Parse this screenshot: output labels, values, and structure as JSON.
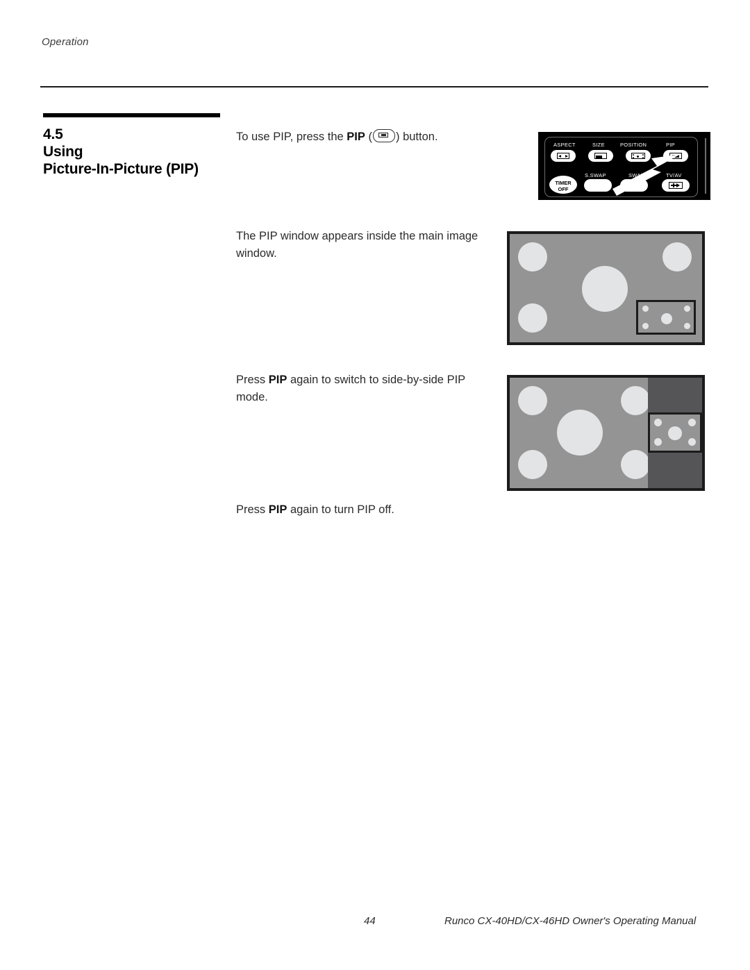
{
  "page": {
    "running_header": "Operation",
    "footer_page_number": "44",
    "footer_title": "Runco CX-40HD/CX-46HD Owner's Operating Manual"
  },
  "section": {
    "number": "4.5",
    "title_line1": "Using",
    "title_line2": "Picture-In-Picture (PIP)"
  },
  "body": {
    "p1_before": "To use PIP, press the ",
    "p1_bold": "PIP",
    "p1_after": " (",
    "p1_end": ") button.",
    "p2": "The PIP window appears inside the main image window.",
    "p3_before": "Press ",
    "p3_bold": "PIP",
    "p3_after": " again to switch to side-by-side PIP mode.",
    "p4_before": "Press ",
    "p4_bold": "PIP",
    "p4_after": " again to turn PIP off."
  },
  "remote": {
    "buttons": [
      {
        "label": "ASPECT",
        "icon": "aspect-icon"
      },
      {
        "label": "SIZE",
        "icon": "size-icon"
      },
      {
        "label": "POSITION",
        "icon": "position-icon"
      },
      {
        "label": "PIP",
        "icon": "pip-icon"
      },
      {
        "label": "S.SWAP",
        "icon": "blank-icon"
      },
      {
        "label": "SWAP",
        "icon": "blank-icon"
      },
      {
        "label": "TV/AV",
        "icon": "tvav-icon"
      }
    ],
    "timer_line1": "TIMER",
    "timer_line2": "OFF",
    "callout": "arrow-pointing-to-pip-button"
  },
  "figures": {
    "pip_inset_caption": "PIP window inside main image window",
    "side_by_side_caption": "Side-by-side PIP mode"
  },
  "colors": {
    "screen_gray": "#949494",
    "side_panel_gray": "#555558",
    "blob_light": "#e3e4e6",
    "border_black": "#1b1b1b",
    "remote_black": "#000000"
  }
}
